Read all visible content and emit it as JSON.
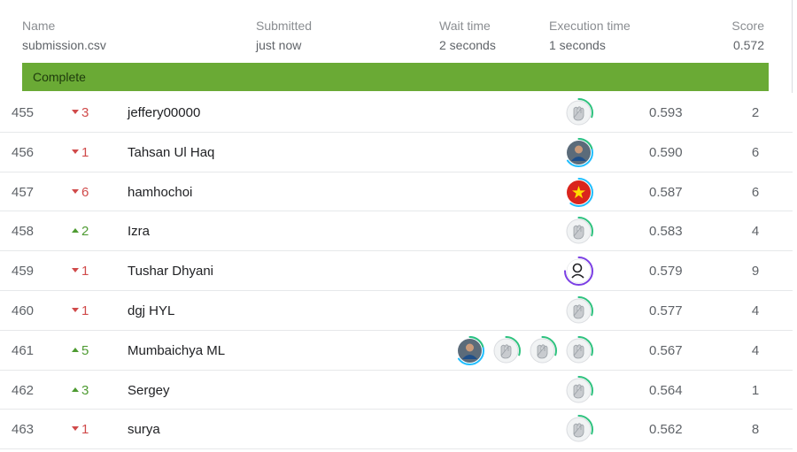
{
  "submission": {
    "name_label": "Name",
    "name_value": "submission.csv",
    "submitted_label": "Submitted",
    "submitted_value": "just now",
    "wait_label": "Wait time",
    "wait_value": "2 seconds",
    "exec_label": "Execution time",
    "exec_value": "1 seconds",
    "score_label": "Score",
    "score_value": "0.572",
    "status": "Complete",
    "status_color": "#6aaa35"
  },
  "colors": {
    "down": "#d04a4a",
    "up": "#4e9b32"
  },
  "rows": [
    {
      "rank": "455",
      "direction": "down",
      "delta": "3",
      "team": "jeffery00000",
      "avatars": [
        "default-avatar"
      ],
      "score": "0.593",
      "entries": "2"
    },
    {
      "rank": "456",
      "direction": "down",
      "delta": "1",
      "team": "Tahsan Ul Haq",
      "avatars": [
        "photo-avatar"
      ],
      "score": "0.590",
      "entries": "6"
    },
    {
      "rank": "457",
      "direction": "down",
      "delta": "6",
      "team": "hamhochoi",
      "avatars": [
        "vietnam-flag-avatar"
      ],
      "score": "0.587",
      "entries": "6"
    },
    {
      "rank": "458",
      "direction": "up",
      "delta": "2",
      "team": "Izra",
      "avatars": [
        "default-avatar"
      ],
      "score": "0.583",
      "entries": "4"
    },
    {
      "rank": "459",
      "direction": "down",
      "delta": "1",
      "team": "Tushar Dhyani",
      "avatars": [
        "sketch-avatar"
      ],
      "score": "0.579",
      "entries": "9"
    },
    {
      "rank": "460",
      "direction": "down",
      "delta": "1",
      "team": "dgj HYL",
      "avatars": [
        "default-avatar"
      ],
      "score": "0.577",
      "entries": "4"
    },
    {
      "rank": "461",
      "direction": "up",
      "delta": "5",
      "team": "Mumbaichya ML",
      "avatars": [
        "photo-avatar",
        "default-avatar",
        "default-avatar",
        "default-avatar"
      ],
      "score": "0.567",
      "entries": "4"
    },
    {
      "rank": "462",
      "direction": "up",
      "delta": "3",
      "team": "Sergey",
      "avatars": [
        "default-avatar"
      ],
      "score": "0.564",
      "entries": "1"
    },
    {
      "rank": "463",
      "direction": "down",
      "delta": "1",
      "team": "surya",
      "avatars": [
        "default-avatar"
      ],
      "score": "0.562",
      "entries": "8"
    }
  ]
}
